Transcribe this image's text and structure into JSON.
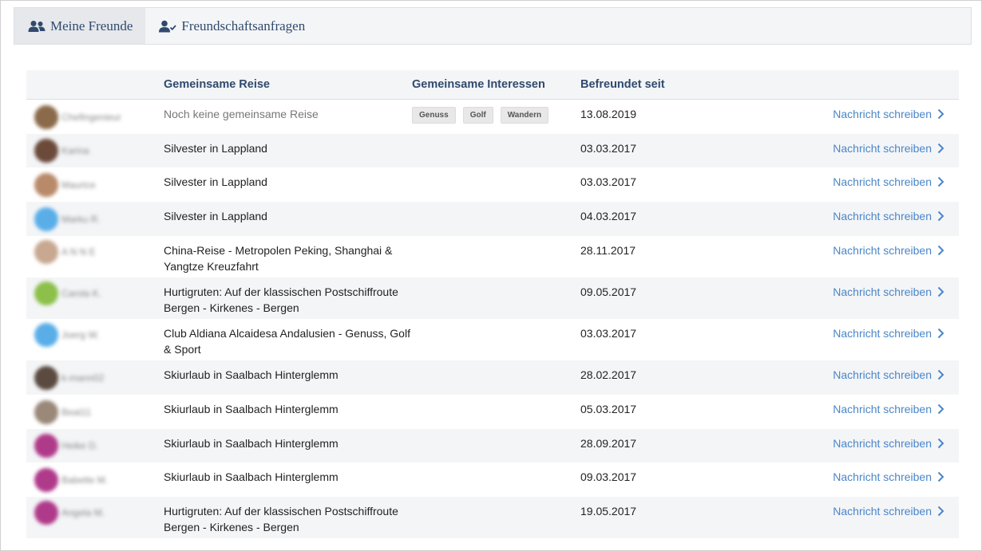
{
  "tabs": [
    {
      "label": "Meine Freunde",
      "icon": "users-icon",
      "active": true
    },
    {
      "label": "Freundschaftsanfragen",
      "icon": "user-check-icon",
      "active": false
    }
  ],
  "table": {
    "headers": {
      "trip": "Gemeinsame Reise",
      "interests": "Gemeinsame Interessen",
      "since": "Befreundet seit"
    },
    "message_label": "Nachricht schreiben",
    "rows": [
      {
        "name": "Chefingenieur",
        "avatar_color": "#8a6a4a",
        "trip": "Noch keine gemeinsame Reise",
        "trip_muted": true,
        "tags": [
          "Genuss",
          "Golf",
          "Wandern"
        ],
        "since": "13.08.2019"
      },
      {
        "name": "Karina",
        "avatar_color": "#6b4a3a",
        "trip": "Silvester in Lappland",
        "tags": [],
        "since": "03.03.2017"
      },
      {
        "name": "Maurice",
        "avatar_color": "#b88a6a",
        "trip": "Silvester in Lappland",
        "tags": [],
        "since": "03.03.2017"
      },
      {
        "name": "Marku R.",
        "avatar_color": "#5aaee8",
        "trip": "Silvester in Lappland",
        "tags": [],
        "since": "04.03.2017"
      },
      {
        "name": "A N N E",
        "avatar_color": "#c8a890",
        "trip": "China-Reise - Metropolen Peking, Shanghai & Yangtze Kreuzfahrt",
        "tags": [],
        "since": "28.11.2017"
      },
      {
        "name": "Carola K.",
        "avatar_color": "#8cc04a",
        "trip": "Hurtigruten: Auf der klassischen Postschiffroute Bergen - Kirkenes - Bergen",
        "tags": [],
        "since": "09.05.2017"
      },
      {
        "name": "Joerg W.",
        "avatar_color": "#5aaee8",
        "trip": "Club Aldiana Alcaidesa Andalusien - Genuss, Golf & Sport",
        "tags": [],
        "since": "03.03.2017"
      },
      {
        "name": "k-mann02",
        "avatar_color": "#5a4a40",
        "trip": "Skiurlaub in Saalbach Hinterglemm",
        "tags": [],
        "since": "28.02.2017"
      },
      {
        "name": "Beat11",
        "avatar_color": "#9a8878",
        "trip": "Skiurlaub in Saalbach Hinterglemm",
        "tags": [],
        "since": "05.03.2017"
      },
      {
        "name": "Heike D.",
        "avatar_color": "#b03a8a",
        "trip": "Skiurlaub in Saalbach Hinterglemm",
        "tags": [],
        "since": "28.09.2017"
      },
      {
        "name": "Babette M.",
        "avatar_color": "#b03a8a",
        "trip": "Skiurlaub in Saalbach Hinterglemm",
        "tags": [],
        "since": "09.03.2017"
      },
      {
        "name": "Angela M.",
        "avatar_color": "#b03a8a",
        "trip": "Hurtigruten: Auf der klassischen Postschiffroute Bergen - Kirkenes - Bergen",
        "tags": [],
        "since": "19.05.2017"
      }
    ]
  },
  "colors": {
    "accent": "#4a86c8",
    "header_text": "#2f4a6d",
    "stripe": "#f4f5f7"
  }
}
